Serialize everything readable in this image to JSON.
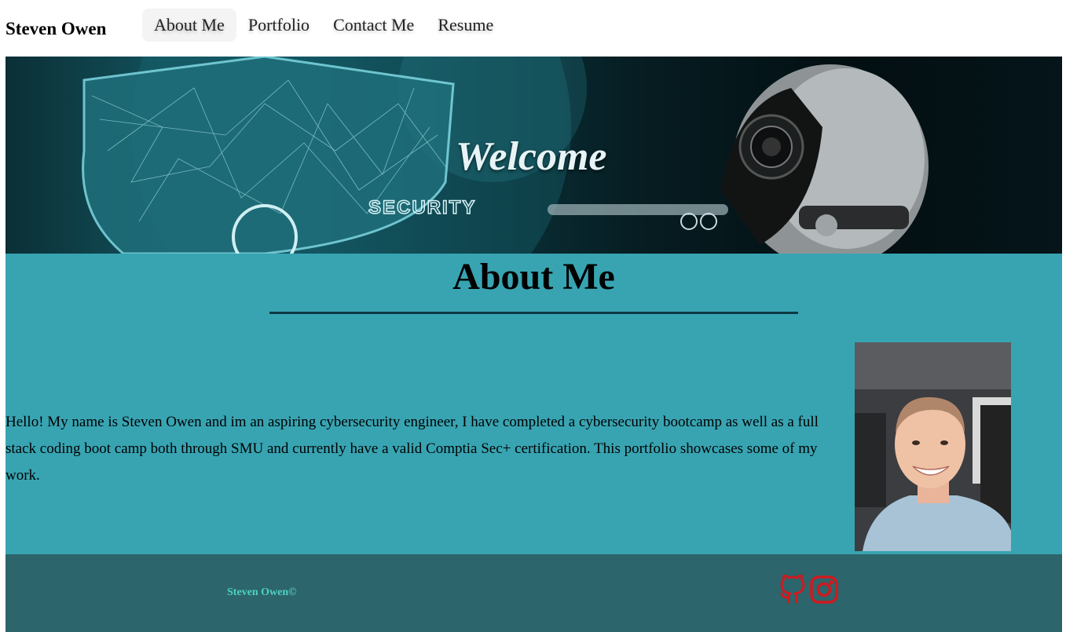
{
  "nav": {
    "brand": "Steven Owen",
    "links": [
      {
        "label": "About Me",
        "active": true
      },
      {
        "label": "Portfolio",
        "active": false
      },
      {
        "label": "Contact Me",
        "active": false
      },
      {
        "label": "Resume",
        "active": false
      }
    ]
  },
  "hero": {
    "title": "Welcome",
    "image_text": "SECURITY"
  },
  "about": {
    "title": "About Me",
    "body": "Hello! My name is Steven Owen and im an aspiring cybersecurity engineer, I have completed a cybersecurity bootcamp as well as a full stack coding boot camp both through SMU and currently have a valid Comptia Sec+ certification. This portfolio showcases some of my work."
  },
  "footer": {
    "copyright": "Steven Owen©",
    "social": [
      {
        "icon": "github-icon"
      },
      {
        "icon": "instagram-icon"
      }
    ]
  },
  "colors": {
    "about_bg": "#38a4b2",
    "footer_bg": "#2c656b",
    "footer_text": "#4fd1c5",
    "social_icon": "#d0191f"
  }
}
